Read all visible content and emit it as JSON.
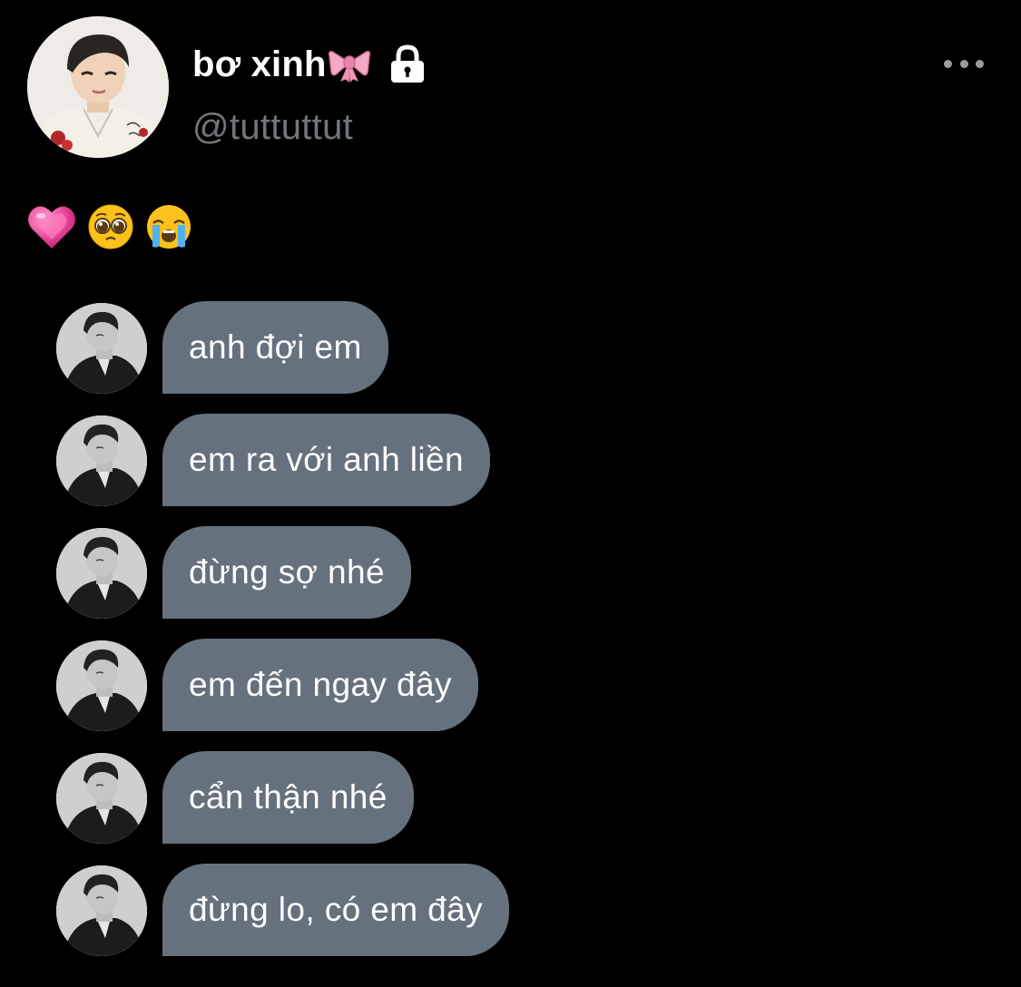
{
  "header": {
    "display_name": "bơ xinh",
    "handle": "@tuttuttut",
    "name_decoration_icon": "pink-bow-icon",
    "protected_icon": "lock-icon",
    "more_icon": "more-horizontal-icon"
  },
  "reaction_emojis": [
    "growing-heart-icon",
    "pleading-face-icon",
    "loudly-crying-face-icon"
  ],
  "chat": {
    "bubble_color": "#66717e",
    "messages": [
      {
        "text": "anh đợi em"
      },
      {
        "text": "em ra với anh liền"
      },
      {
        "text": "đừng sợ nhé"
      },
      {
        "text": "em đến ngay đây"
      },
      {
        "text": "cẩn thận nhé"
      },
      {
        "text": "đừng lo, có em đây"
      }
    ]
  },
  "colors": {
    "background": "#000000",
    "primary_text": "#ffffff",
    "secondary_text": "#71767b"
  }
}
